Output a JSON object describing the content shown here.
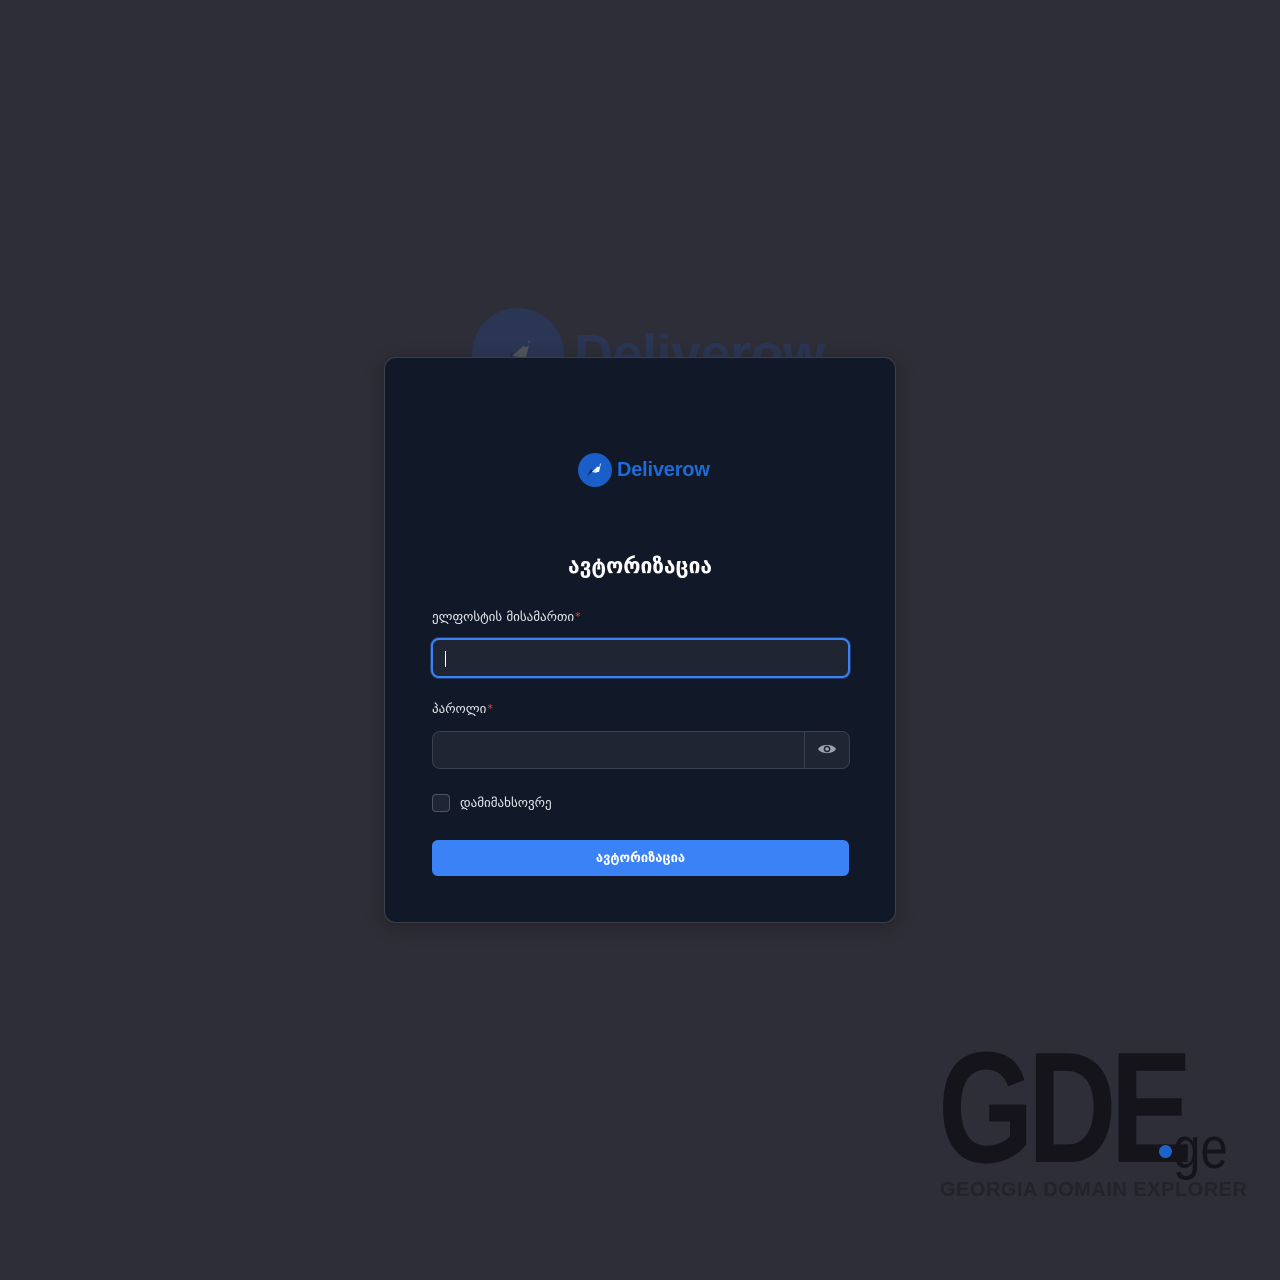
{
  "brand": {
    "name": "Deliverow",
    "color": "#1e6ad8"
  },
  "form": {
    "title": "ავტორიზაცია",
    "email_label": "ელფოსტის მისამართი",
    "email_value": "",
    "password_label": "პაროლი",
    "password_value": "",
    "required_mark": "*",
    "toggle_icon": "eye-icon",
    "remember_label": "დამიმახსოვრე",
    "remember_checked": false,
    "submit_label": "ავტორიზაცია",
    "accent_color": "#3b82f6"
  },
  "watermark": {
    "logo_text": "GDE",
    "logo_suffix": "ge",
    "tagline": "GEORGIA DOMAIN EXPLORER"
  }
}
